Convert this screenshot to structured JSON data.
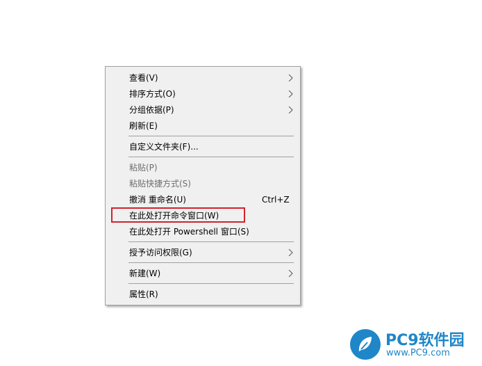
{
  "context_menu": {
    "items": [
      {
        "label": "查看(V)",
        "submenu": true
      },
      {
        "label": "排序方式(O)",
        "submenu": true
      },
      {
        "label": "分组依据(P)",
        "submenu": true
      },
      {
        "label": "刷新(E)"
      },
      {
        "label": "自定义文件夹(F)..."
      },
      {
        "label": "粘贴(P)",
        "disabled": true
      },
      {
        "label": "粘贴快捷方式(S)",
        "disabled": true
      },
      {
        "label": "撤消 重命名(U)",
        "shortcut": "Ctrl+Z"
      },
      {
        "label": "在此处打开命令窗口(W)",
        "highlighted": true
      },
      {
        "label": "在此处打开 Powershell 窗口(S)"
      },
      {
        "label": "授予访问权限(G)",
        "submenu": true
      },
      {
        "label": "新建(W)",
        "submenu": true
      },
      {
        "label": "属性(R)"
      }
    ]
  },
  "watermark": {
    "brand": "PC9软件园",
    "url": "www.PC9.com",
    "color": "#1f86c8"
  },
  "highlight_color": "#d1222c"
}
